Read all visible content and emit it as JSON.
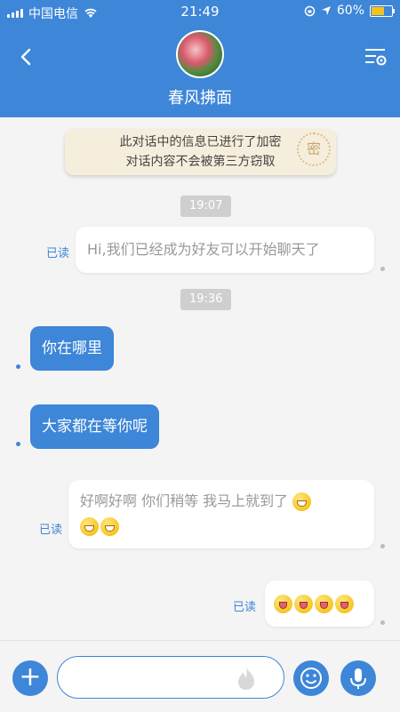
{
  "status_bar": {
    "carrier": "中国电信",
    "time": "21:49",
    "battery": "60%"
  },
  "header": {
    "title": "春风拂面"
  },
  "notice": {
    "line1": "此对话中的信息已进行了加密",
    "line2": "对话内容不会被第三方窃取",
    "seal_text": "密"
  },
  "messages": [
    {
      "type": "time",
      "text": "19:07"
    },
    {
      "type": "out",
      "text": "Hi,我们已经成为好友可以开始聊天了",
      "read": "已读"
    },
    {
      "type": "time",
      "text": "19:36"
    },
    {
      "type": "in",
      "text": "你在哪里"
    },
    {
      "type": "in",
      "text": "大家都在等你呢"
    },
    {
      "type": "out",
      "line1": "好啊好啊  你们稍等  我马上就到了",
      "read": "已读"
    },
    {
      "type": "out",
      "emoji": "tongue",
      "read": "已读"
    }
  ],
  "input_bar": {
    "placeholder": ""
  },
  "colors": {
    "primary": "#3d86d8",
    "background": "#f4f4f4",
    "notice_bg": "#f6eedc"
  }
}
